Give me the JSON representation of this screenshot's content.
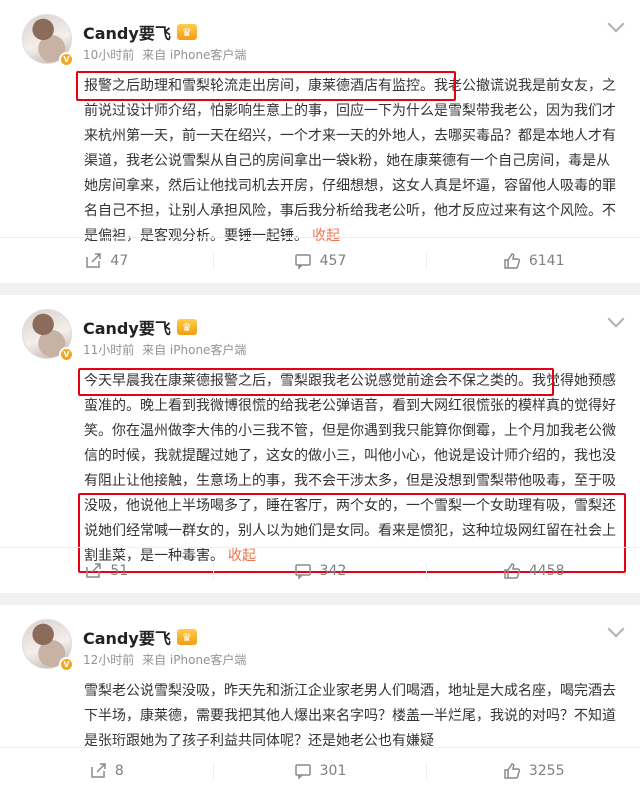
{
  "posts": [
    {
      "author": "Candy要飞",
      "time": "10小时前",
      "source": "来自 iPhone客户端",
      "text": "报警之后助理和雪梨轮流走出房间，康莱德酒店有监控。我老公撤谎说我是前女友，之前说过设计师介绍，怕影响生意上的事，回应一下为什么是雪梨带我老公，因为我们才来杭州第一天，前一天在绍兴，一个才来一天的外地人，去哪买毒品？都是本地人才有渠道，我老公说雪梨从自己的房间拿出一袋k粉，她在康莱德有一个自己房间，毒是从她房间拿来，然后让他找司机去开房，仔细想想，这女人真是坏逼，容留他人吸毒的罪名自己不担，让别人承担风险，事后我分析给我老公听，他才反应过来有这个风险。不是偏袒，是客观分析。要锤一起锤。",
      "collapse": "收起",
      "reposts": "47",
      "comments": "457",
      "likes": "6141"
    },
    {
      "author": "Candy要飞",
      "time": "11小时前",
      "source": "来自 iPhone客户端",
      "text": "今天早晨我在康莱德报警之后，雪梨跟我老公说感觉前途会不保之类的。我觉得她预感蛮准的。晚上看到我微博很慌的给我老公弹语音，看到大网红很慌张的模样真的觉得好笑。你在温州做李大伟的小三我不管，但是你遇到我只能算你倒霉，上个月加我老公微信的时候，我就提醒过她了，这女的做小三，叫他小心，他说是设计师介绍的，我也没有阻止让他接触，生意场上的事，我不会干涉太多，但是没想到雪梨带他吸毒，至于吸没吸，他说他上半场喝多了，睡在客厅，两个女的，一个雪梨一个女助理有吸，雪梨还说她们经常喊一群女的，别人以为她们是女同。看来是惯犯，这种垃圾网红留在社会上割韭菜，是一种毒害。",
      "collapse": "收起",
      "reposts": "51",
      "comments": "342",
      "likes": "4458"
    },
    {
      "author": "Candy要飞",
      "time": "12小时前",
      "source": "来自 iPhone客户端",
      "text": "雪梨老公说雪梨没吸，昨天先和浙江企业家老男人们喝酒，地址是大成名座，喝完酒去下半场，康莱德，需要我把其他人爆出来名字吗？楼盖一半烂尾，我说的对吗？不知道是张珩跟她为了孩子利益共同体呢？还是她老公也有嫌疑",
      "collapse": "",
      "reposts": "8",
      "comments": "301",
      "likes": "3255"
    }
  ],
  "icons": {
    "repost": "repost-icon",
    "comment": "comment-icon",
    "like": "like-icon",
    "more": "chevron-down-icon",
    "verified": "verified-v-icon",
    "member": "member-crown-icon"
  },
  "colors": {
    "highlight_box": "#e60012",
    "collapse_link": "#eb7350",
    "verified": "#f5a623"
  }
}
